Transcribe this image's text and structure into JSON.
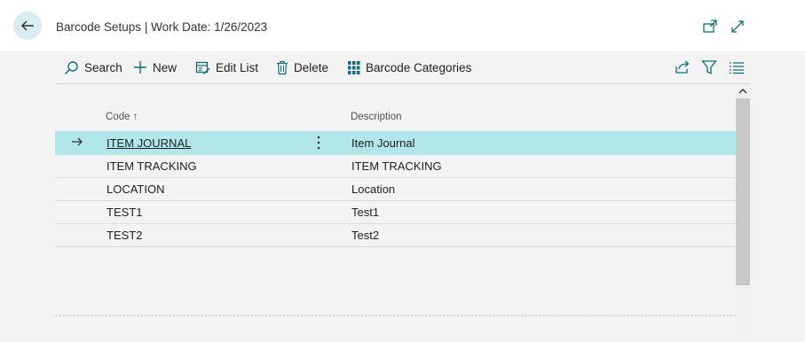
{
  "header": {
    "title": "Barcode Setups | Work Date: 1/26/2023",
    "back_icon": "back-arrow-icon",
    "open_new_window_icon": "open-in-new-window-icon",
    "expand_icon": "expand-icon"
  },
  "toolbar": {
    "items": [
      {
        "label": "Search",
        "icon": "search-icon"
      },
      {
        "label": "New",
        "icon": "plus-icon"
      },
      {
        "label": "Edit List",
        "icon": "edit-list-icon"
      },
      {
        "label": "Delete",
        "icon": "trash-icon"
      },
      {
        "label": "Barcode Categories",
        "icon": "grid-icon"
      }
    ],
    "right_icons": [
      "share-icon",
      "filter-icon",
      "list-view-icon"
    ]
  },
  "list": {
    "columns": [
      {
        "label": "Code",
        "sort": "ascending",
        "sort_icon": "↑"
      },
      {
        "label": "Description"
      }
    ],
    "rows": [
      {
        "code": "ITEM JOURNAL",
        "description": "Item Journal",
        "selected": true
      },
      {
        "code": "ITEM TRACKING",
        "description": "ITEM TRACKING",
        "selected": false
      },
      {
        "code": "LOCATION",
        "description": "Location",
        "selected": false
      },
      {
        "code": "TEST1",
        "description": "Test1",
        "selected": false
      },
      {
        "code": "TEST2",
        "description": "Test2",
        "selected": false
      }
    ]
  },
  "colors": {
    "selected_row": "#b2e7ea",
    "accent": "#0f6e7a"
  }
}
